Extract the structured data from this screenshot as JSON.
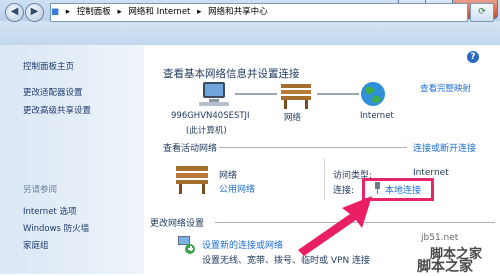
{
  "address_bar": {
    "segments": [
      "控制面板",
      "网络和 Internet",
      "网络和共享中心"
    ],
    "separator": "▸"
  },
  "sidebar": {
    "items": [
      {
        "label": "控制面板主页"
      },
      {
        "label": "更改适配器设置"
      },
      {
        "label": "更改高级共享设置"
      }
    ],
    "see_also_title": "另请参阅",
    "see_also": [
      {
        "label": "Internet 选项"
      },
      {
        "label": "Windows 防火墙"
      },
      {
        "label": "家庭组"
      }
    ]
  },
  "main": {
    "heading": "查看基本网络信息并设置连接",
    "link_full_map": "查看完整映射",
    "map": {
      "computer": {
        "name": "996GHVN40SESTJI",
        "sub": "(此计算机)"
      },
      "network": "网络",
      "internet": "Internet"
    },
    "active": {
      "section_title": "查看活动网络",
      "link_connect_disconnect": "连接或断开连接",
      "network_name": "网络",
      "network_type": "公用网络",
      "access_type_label": "访问类型:",
      "access_type_value": "Internet",
      "connections_label": "连接:",
      "connection_value": "本地连接"
    },
    "change": {
      "section_title": "更改网络设置",
      "tasks": [
        {
          "title": "设置新的连接或网络",
          "desc": "设置无线、宽带、拨号、临时或 VPN 连接"
        }
      ]
    }
  },
  "watermark": {
    "line1": "脚本之家",
    "line2": "脚本之家",
    "url": "jb51.net"
  },
  "colors": {
    "accent_link": "#1e6fd3",
    "highlight": "#e8246a",
    "arrow": "#ea1f63"
  }
}
